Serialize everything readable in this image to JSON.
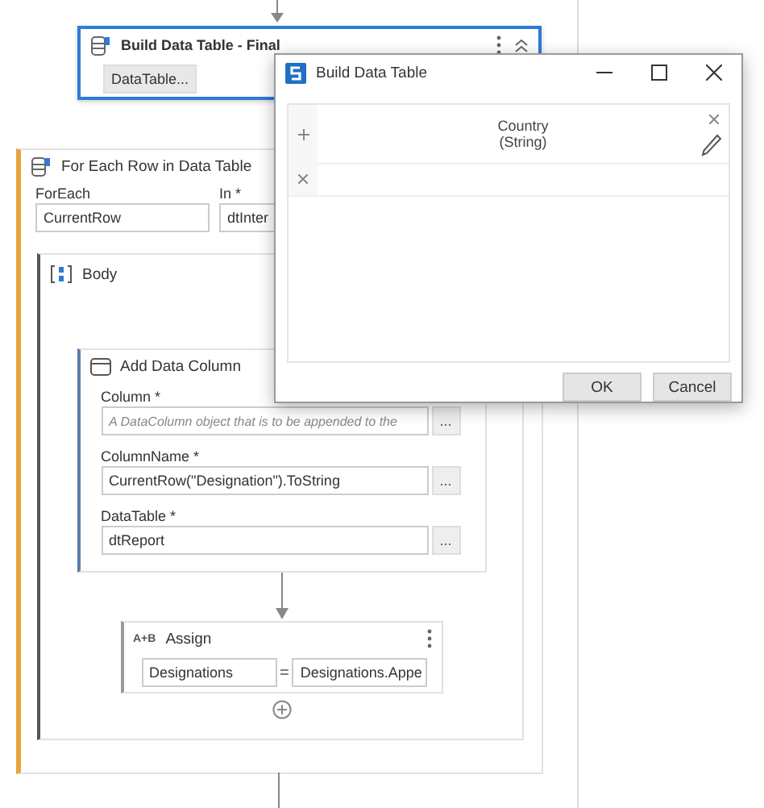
{
  "top_activity": {
    "title": "Build Data Table - Final",
    "button": "DataTable...",
    "selected": true
  },
  "for_each": {
    "title": "For Each Row in Data Table",
    "fields": [
      {
        "label": "ForEach",
        "value": "CurrentRow"
      },
      {
        "label": "In *",
        "value": "dtInter"
      }
    ],
    "body": {
      "title": "Body",
      "add_column": {
        "title": "Add Data Column",
        "fields": [
          {
            "label": "Column *",
            "placeholder": "A DataColumn object that is to be appended to the",
            "button": "..."
          },
          {
            "label": "ColumnName *",
            "value": "CurrentRow(\"Designation\").ToString",
            "button": "..."
          },
          {
            "label": "DataTable *",
            "value": "dtReport",
            "button": "..."
          }
        ]
      },
      "assign": {
        "title": "Assign",
        "icon_text": "A+B",
        "to": "Designations",
        "operator": "=",
        "value": "Designations.Appe"
      }
    }
  },
  "dialog": {
    "title": "Build Data Table",
    "columns": [
      {
        "name": "Country",
        "type": "(String)"
      }
    ],
    "buttons": [
      "OK",
      "Cancel"
    ]
  }
}
